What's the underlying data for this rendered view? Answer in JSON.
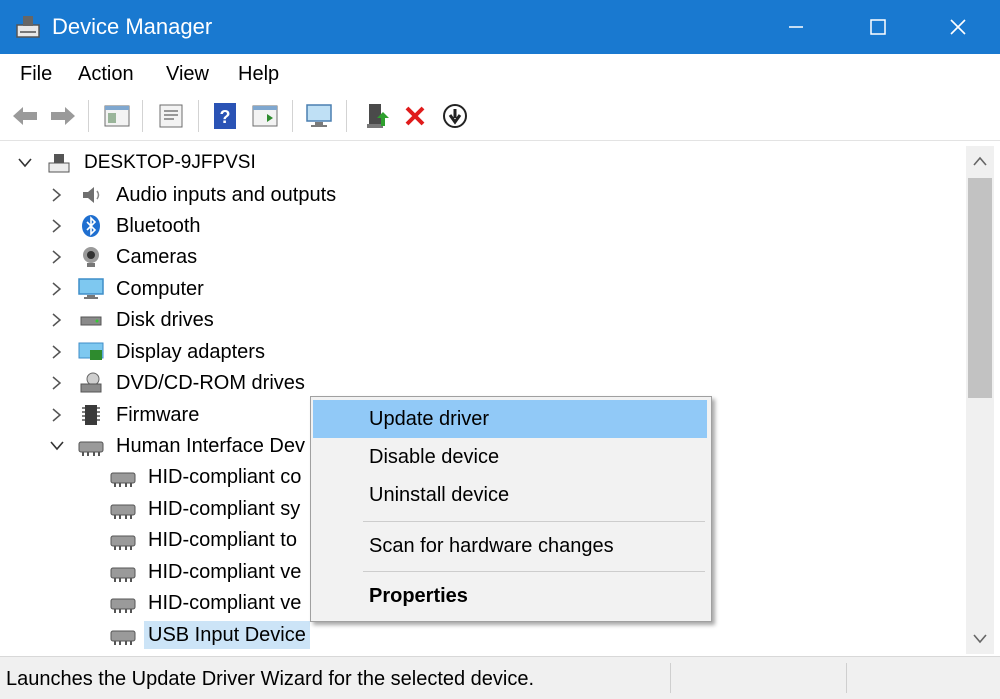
{
  "window": {
    "title": "Device Manager",
    "accent_color": "#1979d0",
    "controls": [
      "minimize-icon",
      "maximize-icon",
      "close-icon"
    ]
  },
  "menu": {
    "file": "File",
    "action": "Action",
    "view": "View",
    "help": "Help"
  },
  "toolbar": {
    "icons": [
      "back-arrow-icon",
      "forward-arrow-icon",
      "show-hide-console-tree-icon",
      "properties-icon",
      "help-icon",
      "action-pane-icon",
      "scan-hardware-icon",
      "update-driver-icon",
      "uninstall-icon",
      "disable-device-icon"
    ]
  },
  "tree": {
    "root": "DESKTOP-9JFPVSI",
    "categories": [
      {
        "label": "Audio inputs and outputs",
        "icon": "speaker-icon"
      },
      {
        "label": "Bluetooth",
        "icon": "bluetooth-icon"
      },
      {
        "label": "Cameras",
        "icon": "camera-icon"
      },
      {
        "label": "Computer",
        "icon": "monitor-icon"
      },
      {
        "label": "Disk drives",
        "icon": "disk-drive-icon"
      },
      {
        "label": "Display adapters",
        "icon": "display-adapter-icon"
      },
      {
        "label": "DVD/CD-ROM drives",
        "icon": "optical-drive-icon"
      },
      {
        "label": "Firmware",
        "icon": "firmware-icon"
      },
      {
        "label": "Human Interface Dev",
        "icon": "hid-icon"
      }
    ],
    "hid_children": [
      "HID-compliant co",
      "HID-compliant sy",
      "HID-compliant to",
      "HID-compliant ve",
      "HID-compliant ve",
      "USB Input Device"
    ],
    "selected_color": "#cce4f7"
  },
  "context_menu": {
    "items": [
      "Update driver",
      "Disable device",
      "Uninstall device"
    ],
    "scan": "Scan for hardware changes",
    "properties": "Properties",
    "highlight_color": "#91c9f7"
  },
  "status": {
    "text": "Launches the Update Driver Wizard for the selected device."
  }
}
